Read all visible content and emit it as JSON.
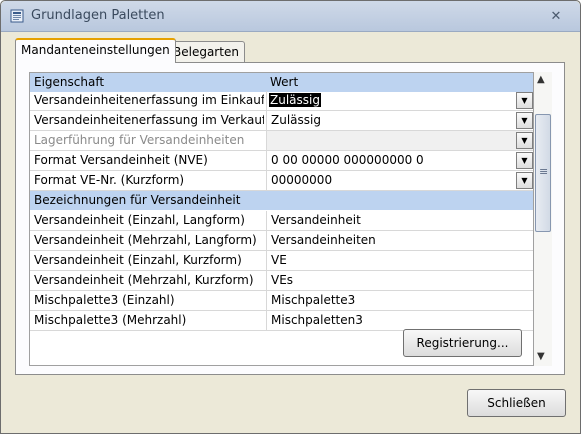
{
  "window": {
    "title": "Grundlagen Paletten",
    "close_glyph": "✕"
  },
  "tabs": [
    {
      "label": "Mandanteneinstellungen",
      "active": true
    },
    {
      "label": "Belegarten",
      "active": false
    }
  ],
  "grid": {
    "columns": [
      "Eigenschaft",
      "Wert"
    ],
    "rows": [
      {
        "property": "Versandeinheitenerfassung im Einkauf",
        "value": "Zulässig",
        "dropdown": true,
        "selected": true
      },
      {
        "property": "Versandeinheitenerfassung im Verkauf",
        "value": "Zulässig",
        "dropdown": true
      },
      {
        "property": "Lagerführung für Versandeinheiten",
        "value": "",
        "dropdown": true,
        "disabled": true
      },
      {
        "property": "Format Versandeinheit (NVE)",
        "value": "0 00 00000 000000000 0",
        "dropdown": true
      },
      {
        "property": "Format VE-Nr. (Kurzform)",
        "value": "00000000",
        "dropdown": true
      },
      {
        "property": "Bezeichnungen für Versandeinheit",
        "value": "",
        "section": true
      },
      {
        "property": "Versandeinheit (Einzahl, Langform)",
        "value": "Versandeinheit"
      },
      {
        "property": "Versandeinheit (Mehrzahl, Langform)",
        "value": "Versandeinheiten"
      },
      {
        "property": "Versandeinheit (Einzahl, Kurzform)",
        "value": "VE"
      },
      {
        "property": "Versandeinheit (Mehrzahl, Kurzform)",
        "value": "VEs"
      },
      {
        "property": "Mischpalette3 (Einzahl)",
        "value": "Mischpalette3"
      },
      {
        "property": "Mischpalette3 (Mehrzahl)",
        "value": "Mischpaletten3"
      }
    ],
    "dropdown_glyph": "▼"
  },
  "scrollbar": {
    "up_glyph": "▲",
    "down_glyph": "▼",
    "grip_glyph": "≡"
  },
  "buttons": {
    "register": "Registrierung...",
    "close": "Schließen"
  },
  "colors": {
    "header_bg": "#bdd3f0",
    "window_bg": "#ece9d8",
    "active_tab_accent": "#e6a100"
  }
}
